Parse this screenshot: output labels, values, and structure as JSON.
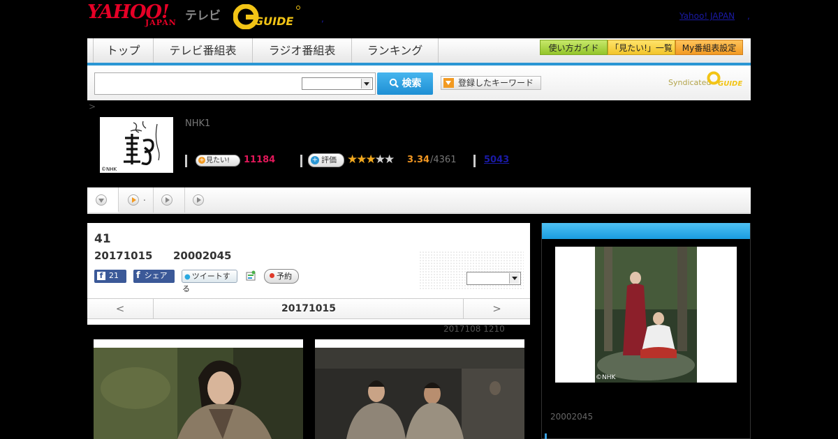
{
  "header": {
    "logo_yahoo": "YAHOO!",
    "logo_japan": "JAPAN",
    "logo_tv": "テレビ",
    "logo_gguide": "G GUIDE",
    "yahoo_japan_link": "Yahoo! JAPAN",
    "link_separator": ",",
    "header_dot": ","
  },
  "nav": {
    "tabs": [
      "トップ",
      "テレビ番組表",
      "ラジオ番組表",
      "ランキング"
    ],
    "buttons": [
      "使い方ガイド",
      "「見たい!」一覧",
      "My番組表設定"
    ]
  },
  "search": {
    "button_label": "検索",
    "keyword_button_label": "登録したキーワード",
    "syndicated": "Syndicated",
    "synd_logo": "G GUIDE"
  },
  "breadcrumb": {
    "separator": ">"
  },
  "program": {
    "thumb_credit": "©NHK",
    "channel": "NHK1",
    "mitai_label": "見たい!",
    "mitai_count": "11184",
    "hyouka_label": "評価",
    "stars": "★★★★★",
    "rating": "3.34",
    "rating_count": "/4361",
    "review_count": "5043",
    "rating_value": 3.34
  },
  "sub_tabs": {
    "tab2_suffix": "."
  },
  "episode": {
    "number": "41",
    "date": "20171015",
    "time": "20002045",
    "facebook_count": "21",
    "share_label": "シェア",
    "tweet_label": "ツイートする",
    "reserve_label": "予約",
    "prev_label": "<",
    "next_label": ">",
    "nav_date": "20171015",
    "update_note": "2017108  1210"
  },
  "side": {
    "image_credit": "©NHK",
    "time": "20002045"
  },
  "colors": {
    "accent_blue": "#2a96d4",
    "yahoo_red": "#e60026",
    "mitai_pink": "#e2185a",
    "rating_orange": "#f29722",
    "nav_button_green": "#a7d13f",
    "nav_button_yellow": "#f6cc31",
    "nav_button_orange": "#f2a72c"
  }
}
